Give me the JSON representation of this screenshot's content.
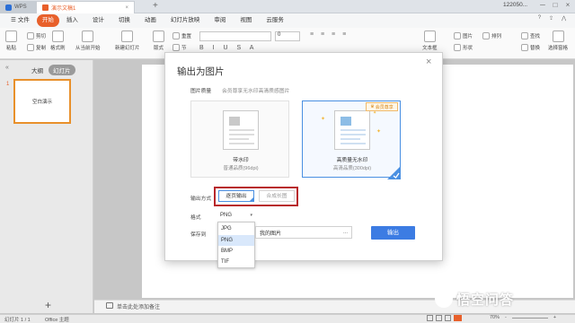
{
  "titlebar": {
    "wps_tab": "WPS",
    "doc_tab": "演示文稿1",
    "doc_tab_close": "×",
    "add_tab": "+",
    "user": "122050...",
    "min": "─",
    "max": "□",
    "close": "×"
  },
  "menu": {
    "file": "文件",
    "items": [
      "开始",
      "插入",
      "设计",
      "切换",
      "动画",
      "幻灯片放映",
      "审阅",
      "视图",
      "云服务"
    ],
    "active": "开始",
    "right_items": [
      "?",
      "⇪",
      "⋀"
    ]
  },
  "toolbar": {
    "paste": "粘贴",
    "cut": "剪切",
    "copy": "复制",
    "format_painter": "格式刷",
    "from_current": "从当前开始",
    "new_slide": "新建幻灯片",
    "layout": "版式",
    "reset": "重置",
    "section": "节",
    "picture": "图片",
    "shape": "形状",
    "arrange": "排列",
    "text_box": "文本框",
    "find": "查找",
    "replace": "替换",
    "select": "选择窗格",
    "font_size": "0"
  },
  "sidebar": {
    "collapse": "«",
    "outline_tab": "大纲",
    "slides_tab": "幻灯片",
    "slide_number": "1",
    "thumb_text": "空白演示",
    "add_slide": "+"
  },
  "notes": {
    "placeholder": "单击此处添加备注"
  },
  "status": {
    "slide": "幻灯片 1 / 1",
    "theme": "Office 主题",
    "zoom": "70%",
    "zoom_minus": "-",
    "zoom_plus": "+"
  },
  "dialog": {
    "title": "输出为图片",
    "close": "×",
    "quality_label": "图片质量",
    "quality_desc": "会员尊享无水印高清质感图片",
    "option_watermark": {
      "title": "带水印",
      "subtitle": "普通品质(96dpi)"
    },
    "option_hq": {
      "title": "高质量无水印",
      "subtitle": "高清品质(300dpi)",
      "badge": "会员尊享"
    },
    "mode_label": "输出方式",
    "mode_single": "逐页输出",
    "mode_merge": "合成长图",
    "format_label": "格式",
    "format_value": "PNG",
    "format_arrow": "▾",
    "format_options": [
      "JPG",
      "PNG",
      "BMP",
      "TIF"
    ],
    "format_selected": "PNG",
    "saveto_label": "保存到",
    "saveto_value": "我的图片",
    "saveto_more": "...",
    "export_button": "输出"
  },
  "watermark": {
    "text": "悟空问答"
  },
  "colors": {
    "accent": "#e8602b",
    "primary_blue": "#3c7ce3",
    "highlight_red": "#b8262b"
  }
}
